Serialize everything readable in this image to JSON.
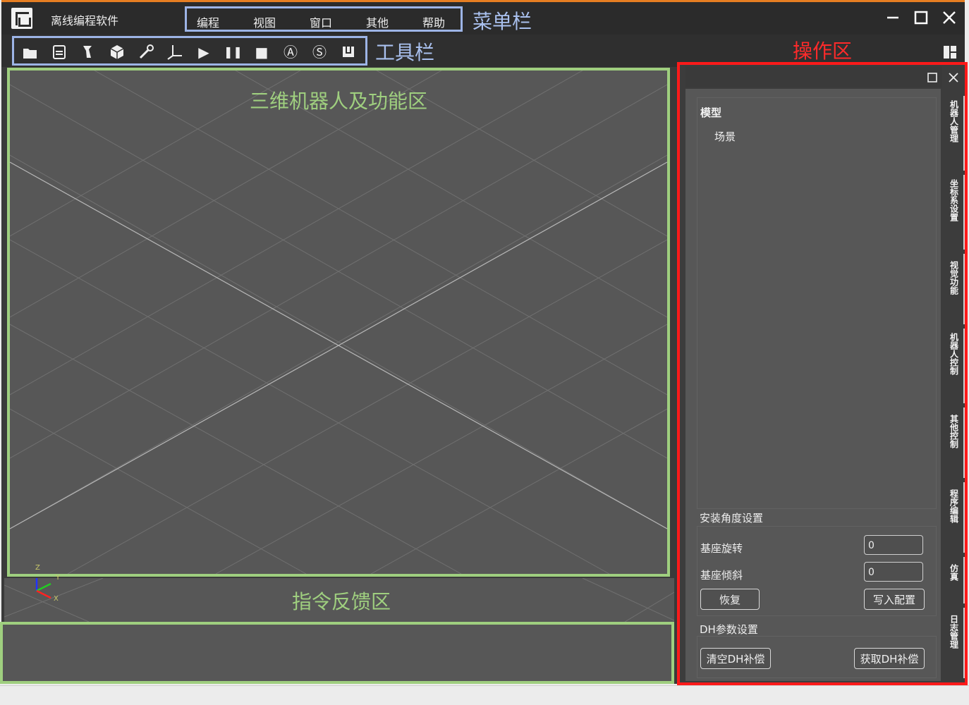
{
  "window": {
    "title": "离线编程软件"
  },
  "menu": {
    "items": [
      "编程",
      "视图",
      "窗口",
      "其他",
      "帮助"
    ]
  },
  "annotations": {
    "menubar": "菜单栏",
    "toolbar": "工具栏",
    "operation_area": "操作区",
    "viewport": "三维机器人及功能区",
    "feedback": "指令反馈区"
  },
  "toolbar": {
    "icons": [
      "open-folder-icon",
      "save-icon",
      "robot-arm-icon",
      "cube-icon",
      "wrench-icon",
      "axes-icon",
      "play-icon",
      "pause-icon",
      "stop-icon",
      "circle-a-icon",
      "circle-s-icon",
      "gripper-icon"
    ],
    "glyphs": [
      "",
      "",
      "",
      "",
      "",
      "",
      "▶",
      "❚❚",
      "■",
      "Ⓐ",
      "Ⓢ",
      ""
    ]
  },
  "viewport": {
    "axis_labels": {
      "z": "Z",
      "y": "Y",
      "x": "X"
    }
  },
  "panel": {
    "tree": {
      "root": "模型",
      "child": "场景"
    },
    "install_angle": {
      "title": "安装角度设置",
      "base_rotation_label": "基座旋转",
      "base_rotation_value": "0",
      "base_tilt_label": "基座倾斜",
      "base_tilt_value": "0",
      "restore_button": "恢复",
      "write_button": "写入配置"
    },
    "dh": {
      "title": "DH参数设置",
      "clear_button": "清空DH补偿",
      "get_button": "获取DH补偿"
    },
    "side_tabs": [
      "机器人管理",
      "坐标系设置",
      "视觉功能",
      "机器人控制",
      "其他控制",
      "程序编辑",
      "仿真",
      "日志管理"
    ]
  },
  "colors": {
    "annotation_blue": "#9db4e6",
    "annotation_green": "#9fcf7f",
    "annotation_red": "#ff1a1a",
    "title_accent": "#e67e22"
  }
}
